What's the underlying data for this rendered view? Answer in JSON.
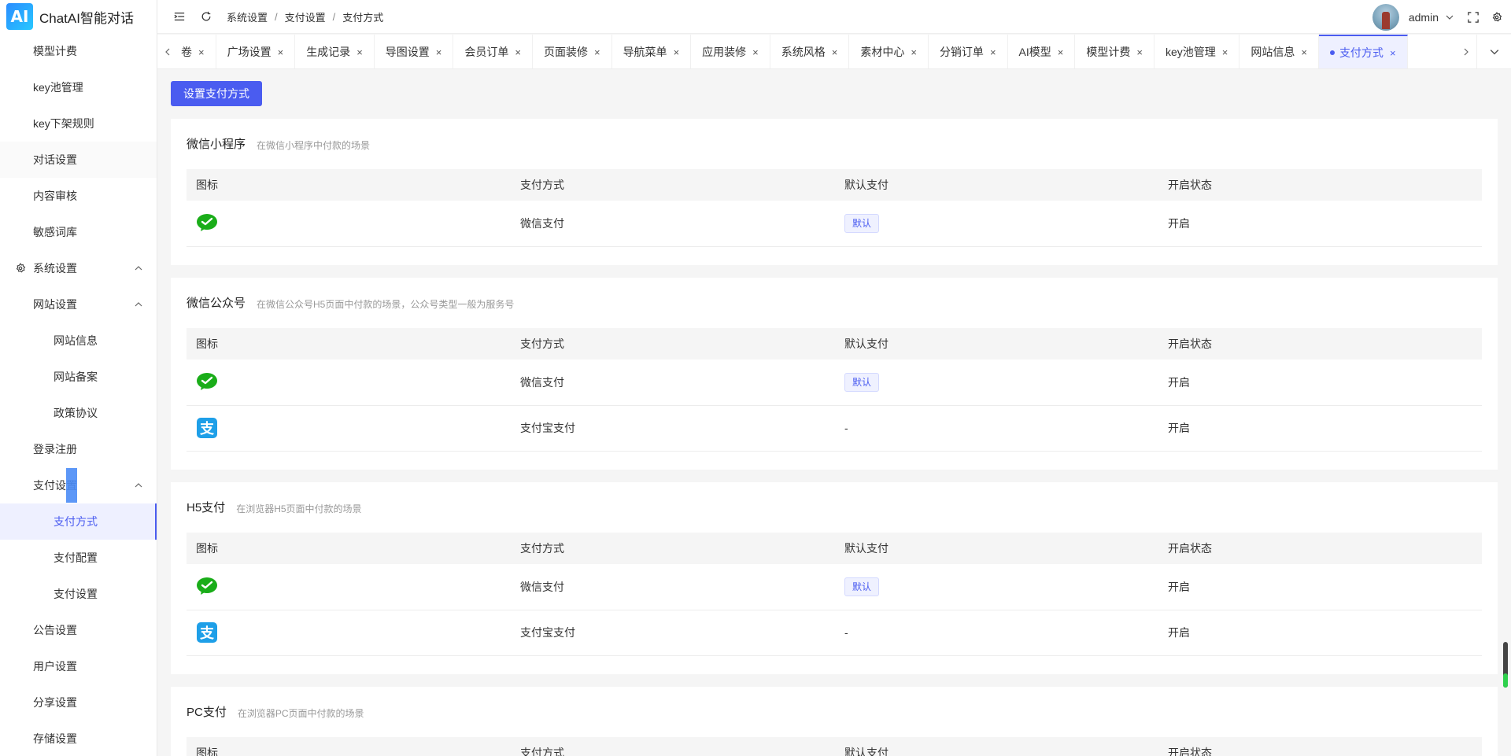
{
  "app": {
    "logo_badge": "AI",
    "title": "ChatAI智能对话"
  },
  "sidebar": {
    "items": [
      {
        "label": "模型计费",
        "level": 1
      },
      {
        "label": "key池管理",
        "level": 1
      },
      {
        "label": "key下架规则",
        "level": 1
      },
      {
        "label": "对话设置",
        "level": 1
      },
      {
        "label": "内容审核",
        "level": 1
      },
      {
        "label": "敏感词库",
        "level": 1
      },
      {
        "label": "系统设置",
        "level": 0
      },
      {
        "label": "网站设置",
        "level": 1
      },
      {
        "label": "网站信息",
        "level": 2
      },
      {
        "label": "网站备案",
        "level": 2
      },
      {
        "label": "政策协议",
        "level": 2
      },
      {
        "label": "登录注册",
        "level": 1
      },
      {
        "label": "支付设置",
        "level": 1
      },
      {
        "label": "支付方式",
        "level": 2
      },
      {
        "label": "支付配置",
        "level": 2
      },
      {
        "label": "支付设置",
        "level": 2
      },
      {
        "label": "公告设置",
        "level": 1
      },
      {
        "label": "用户设置",
        "level": 1
      },
      {
        "label": "分享设置",
        "level": 1
      },
      {
        "label": "存储设置",
        "level": 1
      }
    ]
  },
  "header": {
    "breadcrumb": [
      "系统设置",
      "支付设置",
      "支付方式"
    ],
    "breadcrumb_sep": "/",
    "user": "admin"
  },
  "tabs": {
    "items": [
      "卷",
      "广场设置",
      "生成记录",
      "导图设置",
      "会员订单",
      "页面装修",
      "导航菜单",
      "应用装修",
      "系统风格",
      "素材中心",
      "分销订单",
      "AI模型",
      "模型计费",
      "key池管理",
      "网站信息",
      "支付方式"
    ],
    "close": "×"
  },
  "main": {
    "set_button": "设置支付方式",
    "columns": [
      "图标",
      "支付方式",
      "默认支付",
      "开启状态"
    ],
    "sections": [
      {
        "title": "微信小程序",
        "desc": "在微信小程序中付款的场景",
        "rows": [
          {
            "icon": "wechat-pay-icon",
            "method": "微信支付",
            "default": "默认",
            "status": "开启"
          }
        ]
      },
      {
        "title": "微信公众号",
        "desc": "在微信公众号H5页面中付款的场景，公众号类型一般为服务号",
        "rows": [
          {
            "icon": "wechat-pay-icon",
            "method": "微信支付",
            "default": "默认",
            "status": "开启"
          },
          {
            "icon": "alipay-icon",
            "method": "支付宝支付",
            "default": "-",
            "status": "开启"
          }
        ]
      },
      {
        "title": "H5支付",
        "desc": "在浏览器H5页面中付款的场景",
        "rows": [
          {
            "icon": "wechat-pay-icon",
            "method": "微信支付",
            "default": "默认",
            "status": "开启"
          },
          {
            "icon": "alipay-icon",
            "method": "支付宝支付",
            "default": "-",
            "status": "开启"
          }
        ]
      },
      {
        "title": "PC支付",
        "desc": "在浏览器PC页面中付款的场景",
        "rows": []
      }
    ]
  },
  "colors": {
    "primary": "#4a5cf0",
    "wechat": "#1aad19",
    "alipay": "#1e9fe8"
  }
}
